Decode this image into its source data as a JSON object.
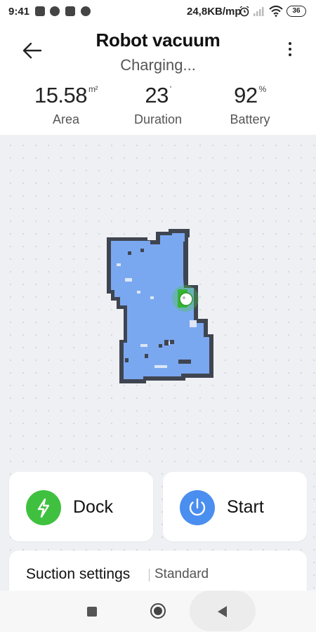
{
  "status_bar": {
    "time": "9:41",
    "network_speed": "24,8KB/mp",
    "battery_level": "36",
    "icons": [
      "k-app-icon",
      "chat-icon",
      "mail-icon",
      "messenger-icon",
      "alarm-icon",
      "signal-icon",
      "wifi-icon",
      "battery-icon"
    ]
  },
  "header": {
    "title": "Robot vacuum",
    "subtitle": "Charging...",
    "back_icon": "arrow-left-icon",
    "menu_icon": "more-vertical-icon"
  },
  "stats": [
    {
      "value": "15.58",
      "unit": "m²",
      "label": "Area"
    },
    {
      "value": "23",
      "unit": "'",
      "label": "Duration"
    },
    {
      "value": "92",
      "unit": "%",
      "label": "Battery"
    }
  ],
  "map": {
    "floor_color": "#7aa8f0",
    "wall_color": "#3f4550",
    "robot_color": "#4cc24a"
  },
  "actions": {
    "dock": {
      "label": "Dock",
      "icon": "lightning-icon",
      "color": "#3fc13f"
    },
    "start": {
      "label": "Start",
      "icon": "power-icon",
      "color": "#4a8ef0"
    }
  },
  "suction": {
    "label": "Suction settings",
    "value": "Standard"
  }
}
